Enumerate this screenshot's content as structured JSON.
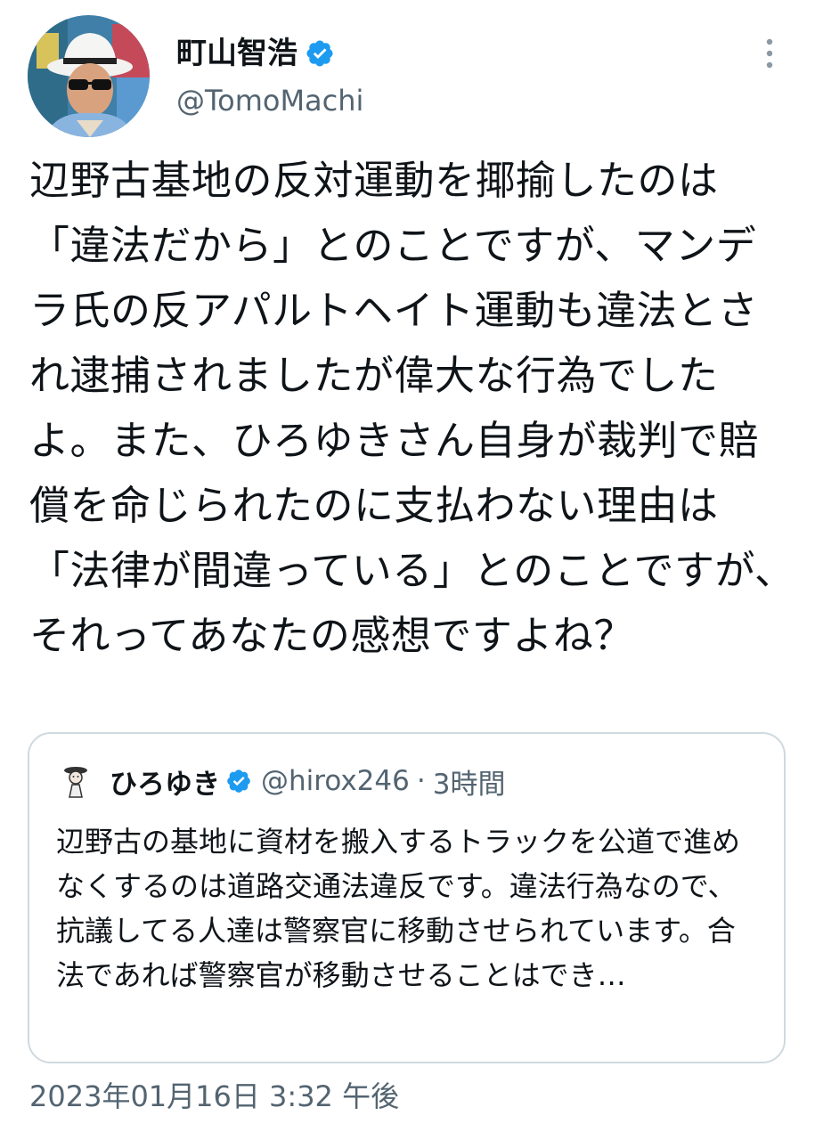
{
  "author": {
    "name": "町山智浩",
    "handle": "@TomoMachi",
    "verified": true
  },
  "tweet": {
    "text": "辺野古基地の反対運動を揶揄したのは「違法だから」とのことですが、マンデラ氏の反アパルトヘイト運動も違法とされ逮捕されましたが偉大な行為でしたよ。また、ひろゆきさん自身が裁判で賠償を命じられたのに支払わない理由は「法律が間違っている」とのことですが、それってあなたの感想ですよね？"
  },
  "quoted": {
    "name": "ひろゆき",
    "handle": "@hirox246",
    "separator": "·",
    "time": "3時間",
    "text": "辺野古の基地に資材を搬入するトラックを公道で進めなくするのは道路交通法違反です。違法行為なので、抗議してる人達は警察官に移動させられています。合法であれば警察官が移動させることはでき…"
  },
  "timestamp": "2023年01月16日 3:32 午後",
  "icons": {
    "verified": "verified-badge-icon",
    "more": "more-vertical-icon"
  },
  "colors": {
    "verified": "#1d9bf0",
    "secondary_text": "#536471",
    "primary_text": "#0f1419",
    "border": "#cfd9de"
  }
}
